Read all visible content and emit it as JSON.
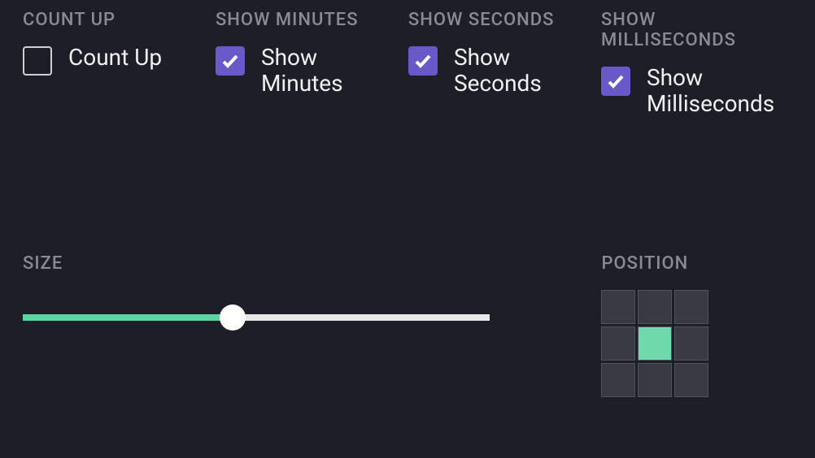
{
  "options": {
    "countUp": {
      "heading": "COUNT UP",
      "label": "Count Up",
      "checked": false
    },
    "showMinutes": {
      "heading": "SHOW MINUTES",
      "label": "Show Minutes",
      "checked": true
    },
    "showSeconds": {
      "heading": "SHOW SECONDS",
      "label": "Show Seconds",
      "checked": true
    },
    "showMilliseconds": {
      "heading": "SHOW MILLISECONDS",
      "label": "Show Milliseconds",
      "checked": true
    }
  },
  "size": {
    "heading": "SIZE",
    "value": 45,
    "min": 0,
    "max": 100
  },
  "position": {
    "heading": "POSITION",
    "selected": 4
  },
  "colors": {
    "accentCheckbox": "#6858c8",
    "accentSlider": "#5dd3a0",
    "accentPosition": "#6fd9ab"
  }
}
